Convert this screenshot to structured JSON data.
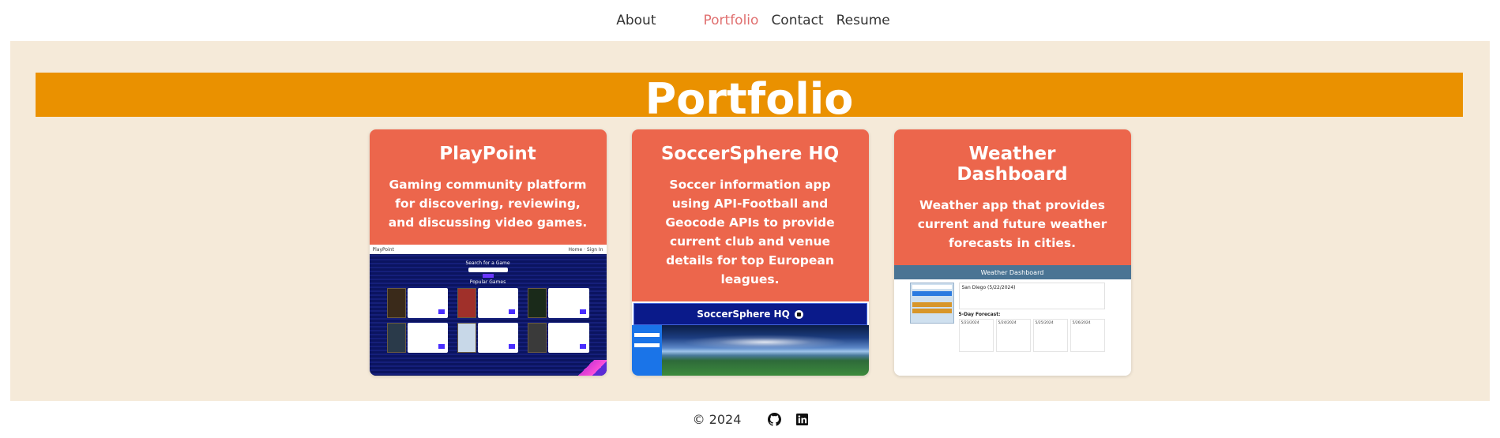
{
  "nav": {
    "items": [
      {
        "label": "About",
        "active": false
      },
      {
        "label": "Portfolio",
        "active": true
      },
      {
        "label": "Contact",
        "active": false
      },
      {
        "label": "Resume",
        "active": false
      }
    ]
  },
  "page": {
    "title": "Portfolio"
  },
  "projects": [
    {
      "title": "PlayPoint",
      "description": "Gaming community platform for discovering, reviewing, and discussing video games.",
      "screenshot": {
        "search_heading": "Search for a Game",
        "popular_heading": "Popular Games"
      }
    },
    {
      "title": "SoccerSphere HQ",
      "description": "Soccer information app using API-Football and Geocode APIs to provide current club and venue details for top European leagues.",
      "screenshot": {
        "header": "SoccerSphere HQ"
      }
    },
    {
      "title": "Weather Dashboard",
      "description": "Weather app that provides current and future weather forecasts in cities.",
      "screenshot": {
        "header": "Weather Dashboard",
        "city_line": "San Diego (5/22/2024)",
        "forecast_heading": "5-Day Forecast:",
        "days": [
          "5/23/2024",
          "5/24/2024",
          "5/25/2024",
          "5/26/2024"
        ]
      }
    }
  ],
  "footer": {
    "copyright": "© 2024",
    "icons": [
      "github-icon",
      "linkedin-icon"
    ]
  },
  "colors": {
    "banner": "#ea9100",
    "card_header": "#ec664c",
    "background": "#f5ead9",
    "nav_active": "#e07070"
  }
}
